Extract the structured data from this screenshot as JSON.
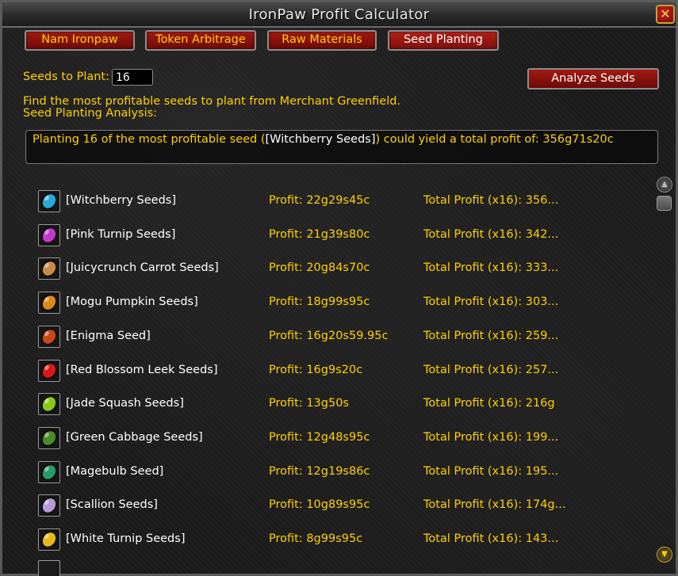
{
  "window": {
    "title": "IronPaw Profit Calculator",
    "close_label": "✕"
  },
  "tabs": [
    {
      "label": "Nam Ironpaw",
      "active": false
    },
    {
      "label": "Token Arbitrage",
      "active": false
    },
    {
      "label": "Raw Materials",
      "active": false
    },
    {
      "label": "Seed Planting",
      "active": true
    }
  ],
  "form": {
    "seeds_label": "Seeds to Plant:",
    "seeds_value": "16",
    "analyze_label": "Analyze Seeds"
  },
  "description": "Find the most profitable seeds to plant from Merchant Greenfield.",
  "analysis_label": "Seed Planting Analysis:",
  "summary": {
    "prefix": "Planting 16 of the most profitable seed (",
    "item": "[Witchberry Seeds]",
    "suffix": ") could yield a total profit of: 356g71s20c"
  },
  "seeds": [
    {
      "name": "[Witchberry Seeds]",
      "profit": "Profit: 22g29s45c",
      "total": "Total Profit (x16): 356...",
      "icon": "witchberry-seeds-icon",
      "color": "#2aa8d8"
    },
    {
      "name": "[Pink Turnip Seeds]",
      "profit": "Profit: 21g39s80c",
      "total": "Total Profit (x16): 342...",
      "icon": "pink-turnip-seeds-icon",
      "color": "#c23ac8"
    },
    {
      "name": "[Juicycrunch Carrot Seeds]",
      "profit": "Profit: 20g84s70c",
      "total": "Total Profit (x16): 333...",
      "icon": "juicycrunch-carrot-seeds-icon",
      "color": "#c88a4a"
    },
    {
      "name": "[Mogu Pumpkin Seeds]",
      "profit": "Profit: 18g99s95c",
      "total": "Total Profit (x16): 303...",
      "icon": "mogu-pumpkin-seeds-icon",
      "color": "#d88a1a"
    },
    {
      "name": "[Enigma Seed]",
      "profit": "Profit: 16g20s59.95c",
      "total": "Total Profit (x16): 259...",
      "icon": "enigma-seed-icon",
      "color": "#c8481a"
    },
    {
      "name": "[Red Blossom Leek Seeds]",
      "profit": "Profit: 16g9s20c",
      "total": "Total Profit (x16): 257...",
      "icon": "red-blossom-leek-seeds-icon",
      "color": "#d81a1a"
    },
    {
      "name": "[Jade Squash Seeds]",
      "profit": "Profit: 13g50s",
      "total": "Total Profit (x16): 216g",
      "icon": "jade-squash-seeds-icon",
      "color": "#8ac81a"
    },
    {
      "name": "[Green Cabbage Seeds]",
      "profit": "Profit: 12g48s95c",
      "total": "Total Profit (x16): 199...",
      "icon": "green-cabbage-seeds-icon",
      "color": "#4a8a2a"
    },
    {
      "name": "[Magebulb Seed]",
      "profit": "Profit: 12g19s86c",
      "total": "Total Profit (x16): 195...",
      "icon": "magebulb-seed-icon",
      "color": "#2a9a6a"
    },
    {
      "name": "[Scallion Seeds]",
      "profit": "Profit: 10g89s95c",
      "total": "Total Profit (x16): 174g...",
      "icon": "scallion-seeds-icon",
      "color": "#b89ad8"
    },
    {
      "name": "[White Turnip Seeds]",
      "profit": "Profit: 8g99s95c",
      "total": "Total Profit (x16): 143...",
      "icon": "white-turnip-seeds-icon",
      "color": "#e8b81a"
    }
  ],
  "scrollbar": {
    "up_glyph": "▲",
    "down_glyph": "▼"
  }
}
